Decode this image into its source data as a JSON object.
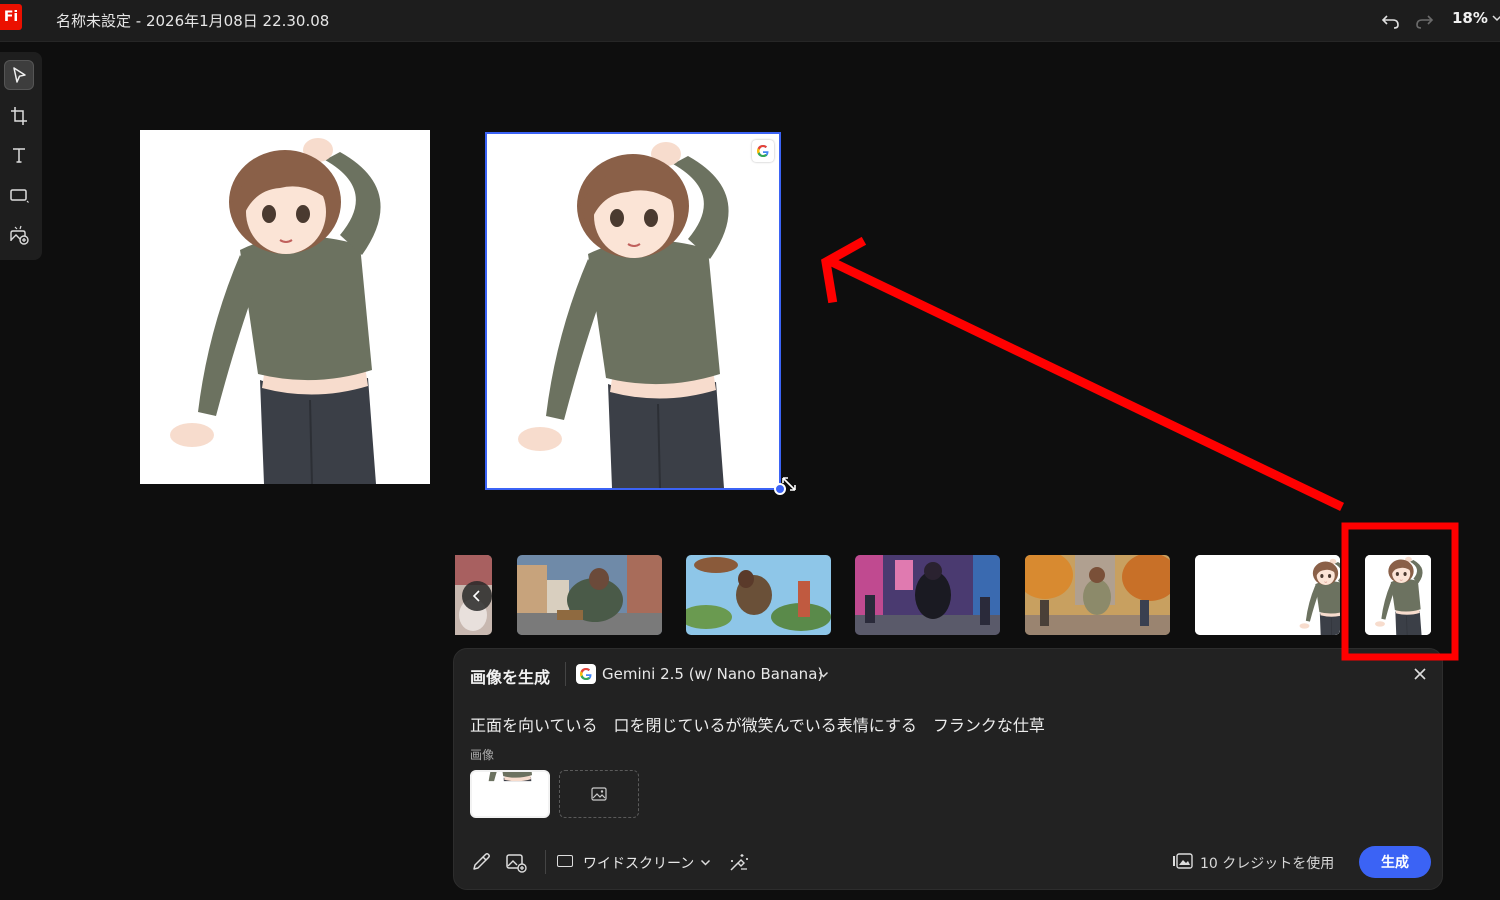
{
  "app": {
    "logo_text": "Fi",
    "document_title": "名称未設定 - 2026年1月08日 22.30.08",
    "zoom_level": "18%"
  },
  "toolbar": {
    "tools": [
      "select-tool",
      "frame-tool",
      "text-tool",
      "shape-tool",
      "generate-image-tool"
    ],
    "active_tool": "select-tool"
  },
  "canvas": {
    "selected_badge_icon": "google-icon"
  },
  "thumbnails": {
    "items": [
      "thumb-city-sitting",
      "thumb-floating-island",
      "thumb-neon-street",
      "thumb-autumn-street",
      "thumb-character-white",
      "thumb-character-closeup"
    ],
    "highlighted_item": "thumb-character-closeup"
  },
  "panel": {
    "title": "画像を生成",
    "model_name": "Gemini 2.5 (w/ Nano Banana)",
    "prompt_text": "正面を向いている　口を閉じているが微笑んでいる表情にする　フランクな仕草",
    "image_section_label": "画像",
    "aspect_label": "ワイドスクリーン",
    "credits_label": "10 クレジットを使用",
    "generate_label": "生成"
  },
  "colors": {
    "accent": "#3b63f5",
    "annotation_red": "#ff0000",
    "adobe_red": "#eb1000"
  }
}
